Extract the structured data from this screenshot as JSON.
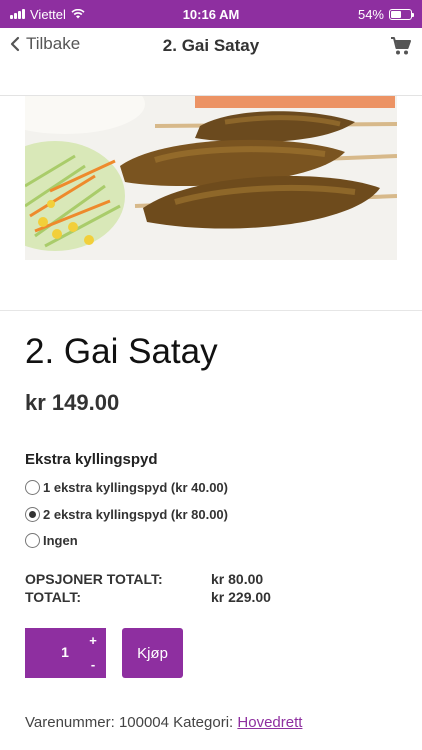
{
  "status_bar": {
    "carrier": "Viettel",
    "time": "10:16 AM",
    "battery": "54%",
    "battery_level": 0.54
  },
  "nav": {
    "back_label": "Tilbake",
    "title": "2. Gai Satay",
    "cart_icon": "cart-icon"
  },
  "product": {
    "title": "2. Gai Satay",
    "price": "kr 149.00",
    "options_heading": "Ekstra kyllingspyd",
    "options": [
      {
        "label": "1 ekstra kyllingspyd (kr 40.00)",
        "checked": false
      },
      {
        "label": "2 ekstra kyllingspyd (kr 80.00)",
        "checked": true
      },
      {
        "label": "Ingen",
        "checked": false
      }
    ],
    "options_total_label": "OPSJONER TOTALT:",
    "options_total_value": "kr 80.00",
    "total_label": "TOTALT:",
    "total_value": "kr 229.00"
  },
  "cart": {
    "quantity": "1",
    "plus": "+",
    "minus": "-",
    "buy_label": "Kjøp"
  },
  "meta": {
    "sku_label": "Varenummer:",
    "sku": "100004",
    "category_label": "Kategori:",
    "category": "Hovedrett"
  },
  "colors": {
    "accent": "#8e2fa0"
  }
}
